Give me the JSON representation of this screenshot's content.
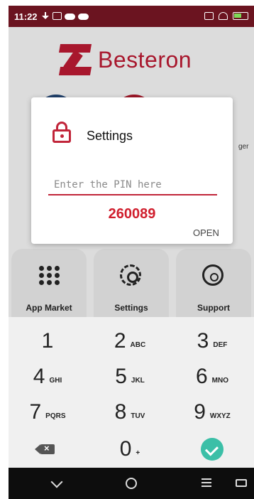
{
  "status_bar": {
    "time": "11:22",
    "icons": [
      "download-icon",
      "message-icon",
      "cloud-icon",
      "cloud-icon",
      "cast-icon",
      "wifi-icon",
      "battery-icon"
    ]
  },
  "background_app": {
    "brand": "Besteron",
    "partial_label": "ger",
    "tiles": [
      {
        "label": "App Market",
        "icon": "apps-icon"
      },
      {
        "label": "Settings",
        "icon": "gear-icon"
      },
      {
        "label": "Support",
        "icon": "headset-icon"
      }
    ]
  },
  "dialog": {
    "title": "Settings",
    "icon": "lock-icon",
    "pin_placeholder": "Enter the PIN here",
    "pin_value": "",
    "displayed_pin": "260089",
    "open_label": "OPEN"
  },
  "keypad": {
    "keys": [
      {
        "num": "1",
        "letters": ""
      },
      {
        "num": "2",
        "letters": "ABC"
      },
      {
        "num": "3",
        "letters": "DEF"
      },
      {
        "num": "4",
        "letters": "GHI"
      },
      {
        "num": "5",
        "letters": "JKL"
      },
      {
        "num": "6",
        "letters": "MNO"
      },
      {
        "num": "7",
        "letters": "PQRS"
      },
      {
        "num": "8",
        "letters": "TUV"
      },
      {
        "num": "9",
        "letters": "WXYZ"
      },
      {
        "num": "0",
        "letters": "+"
      }
    ],
    "accent": "#3bbfa7"
  },
  "nav_bar": {
    "icons": [
      "back-icon",
      "home-icon",
      "menu-icon",
      "keyboard-icon"
    ]
  },
  "colors": {
    "brand": "#a8172d",
    "status_bar": "#6b1420",
    "pin_red": "#d01e2d"
  }
}
